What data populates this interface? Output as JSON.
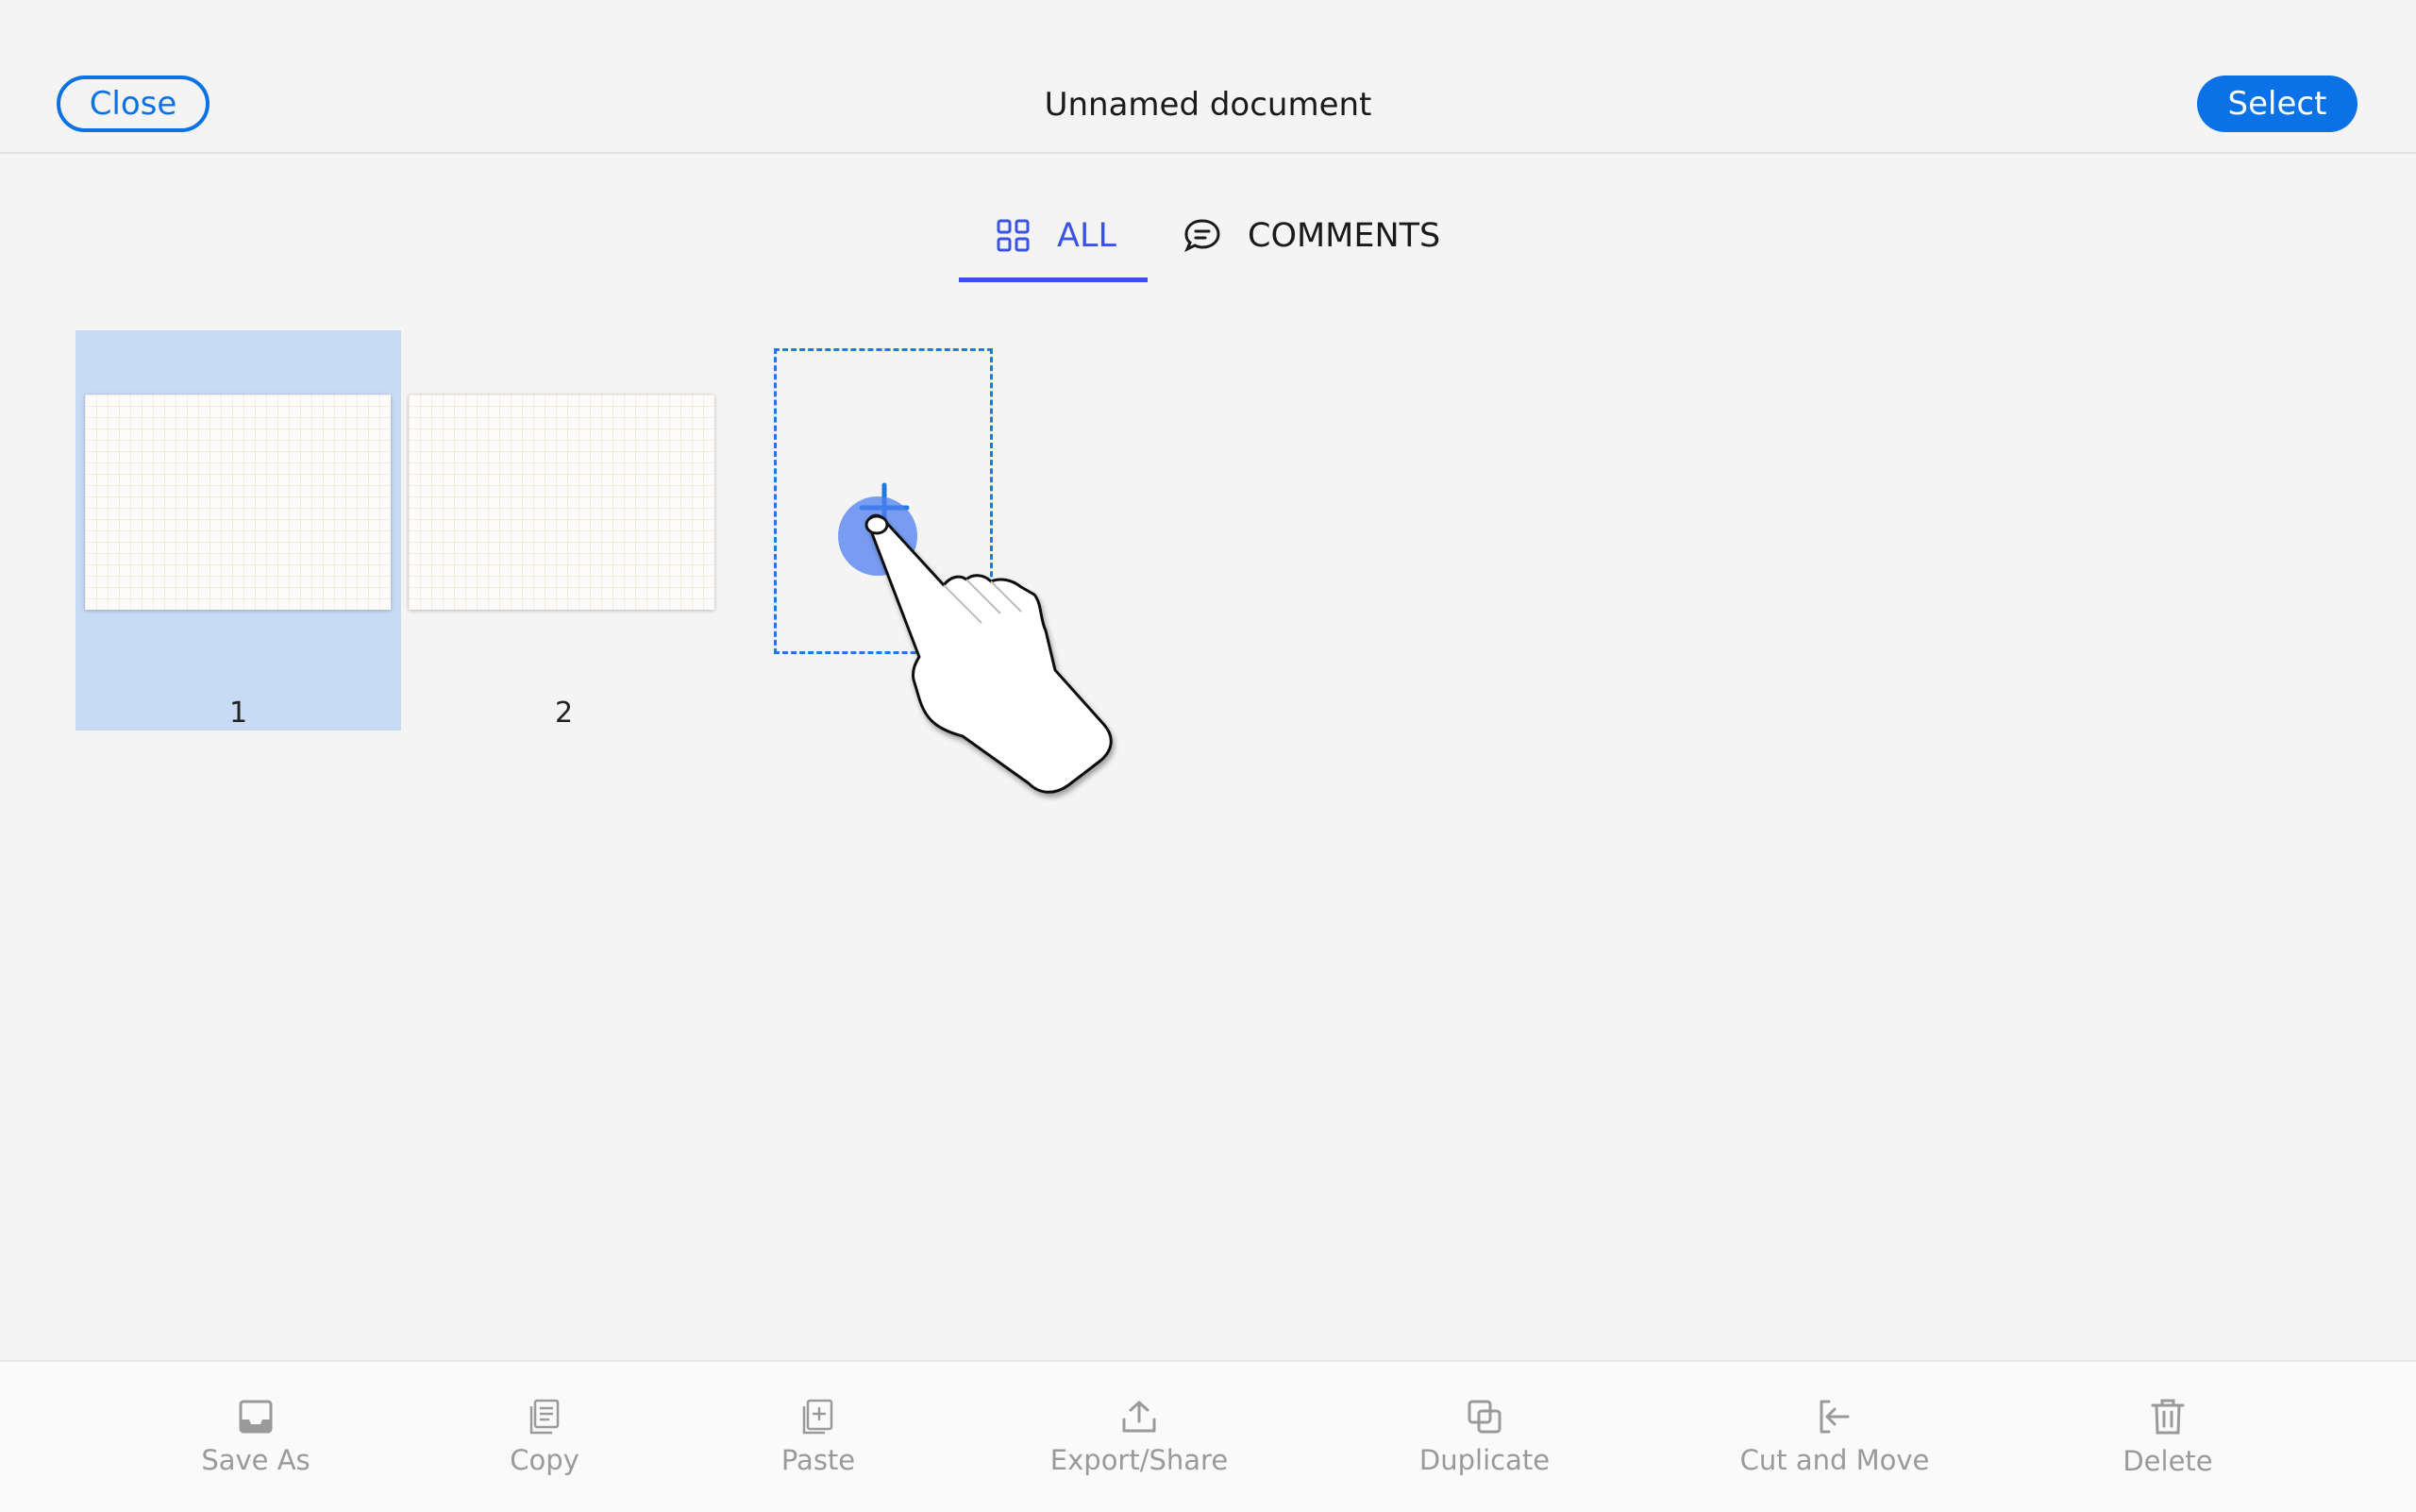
{
  "header": {
    "close_label": "Close",
    "title": "Unnamed document",
    "select_label": "Select"
  },
  "tabs": [
    {
      "label": "ALL",
      "active": true,
      "icon": "grid-icon"
    },
    {
      "label": "COMMENTS",
      "active": false,
      "icon": "comment-icon"
    }
  ],
  "pages": [
    {
      "number": "1",
      "selected": true
    },
    {
      "number": "2",
      "selected": false
    }
  ],
  "add_page": {
    "icon": "plus-icon"
  },
  "toolbar": [
    {
      "label": "Save As",
      "icon": "save-as-icon"
    },
    {
      "label": "Copy",
      "icon": "copy-icon"
    },
    {
      "label": "Paste",
      "icon": "paste-icon"
    },
    {
      "label": "Export/Share",
      "icon": "export-icon"
    },
    {
      "label": "Duplicate",
      "icon": "duplicate-icon"
    },
    {
      "label": "Cut and Move",
      "icon": "cut-move-icon"
    },
    {
      "label": "Delete",
      "icon": "delete-icon"
    }
  ],
  "colors": {
    "accent": "#0a72e6",
    "tab_active": "#3b54e0",
    "selected_tile": "#c7dbf5",
    "toolbar_text": "#9a9a9a"
  }
}
